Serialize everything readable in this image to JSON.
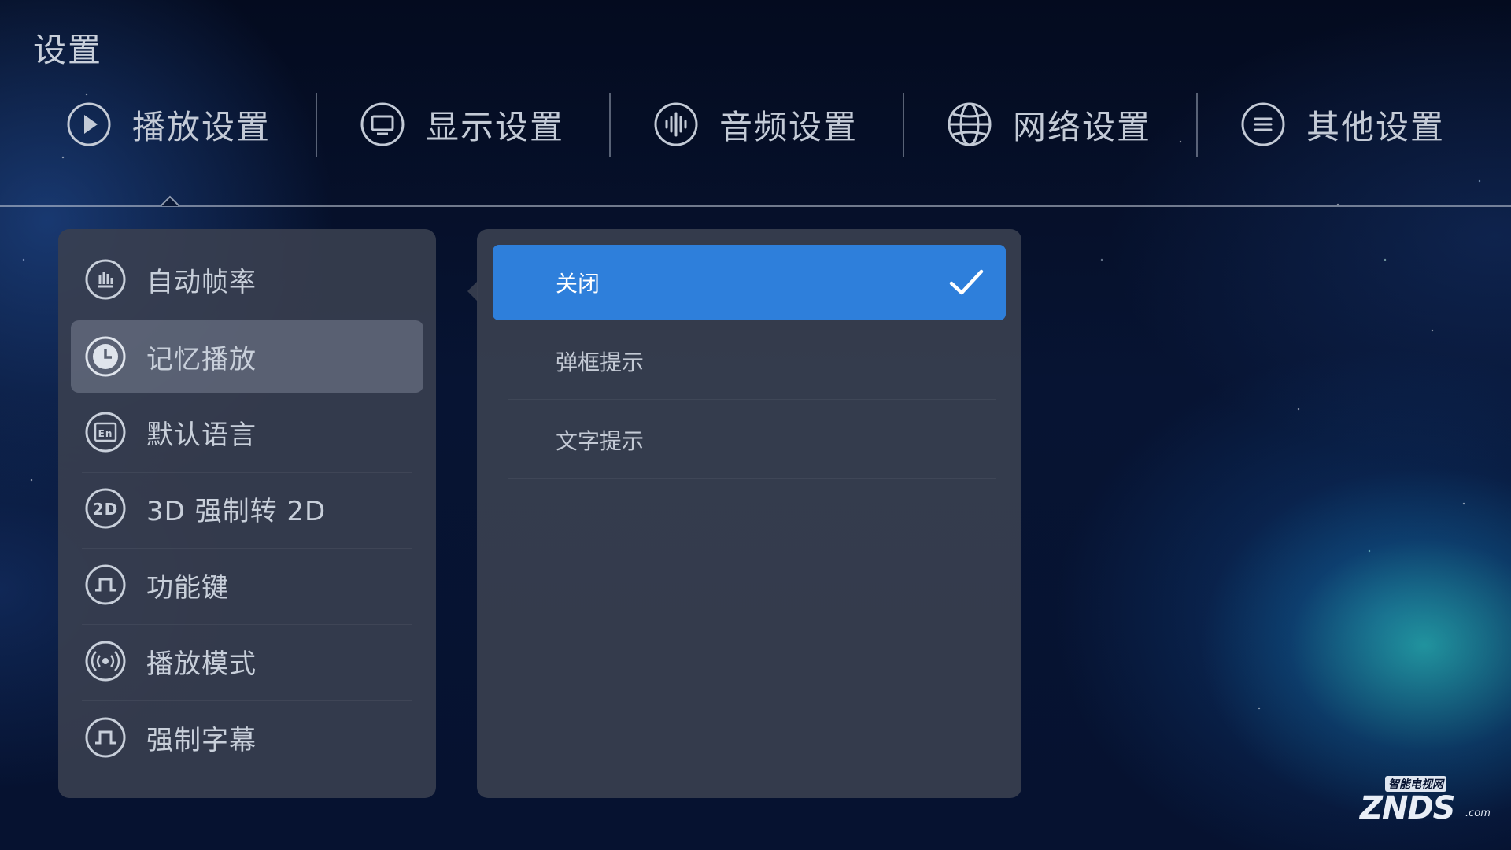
{
  "page": {
    "title": "设置"
  },
  "tabs": [
    {
      "label": "播放设置",
      "icon": "play-circle-icon",
      "active": true
    },
    {
      "label": "显示设置",
      "icon": "monitor-icon"
    },
    {
      "label": "音频设置",
      "icon": "audio-wave-icon"
    },
    {
      "label": "网络设置",
      "icon": "globe-icon"
    },
    {
      "label": "其他设置",
      "icon": "menu-lines-icon"
    }
  ],
  "sidebar": {
    "items": [
      {
        "label": "自动帧率",
        "icon": "bar-chart-icon"
      },
      {
        "label": "记忆播放",
        "icon": "clock-icon",
        "selected": true
      },
      {
        "label": "默认语言",
        "icon": "language-en-icon"
      },
      {
        "label": "3D 强制转 2D",
        "icon": "2d-icon"
      },
      {
        "label": "功能键",
        "icon": "pulse-key-icon"
      },
      {
        "label": "播放模式",
        "icon": "broadcast-icon"
      },
      {
        "label": "强制字幕",
        "icon": "pulse-subtitle-icon"
      }
    ]
  },
  "options": {
    "items": [
      {
        "label": "关闭",
        "checked": true
      },
      {
        "label": "弹框提示"
      },
      {
        "label": "文字提示"
      }
    ]
  },
  "watermark": {
    "tag": "智能电视网",
    "brand": "ZNDS",
    "domain": ".com"
  },
  "colors": {
    "accent": "#2e7fdb",
    "panel": "#3a4050",
    "background": "#061230"
  }
}
